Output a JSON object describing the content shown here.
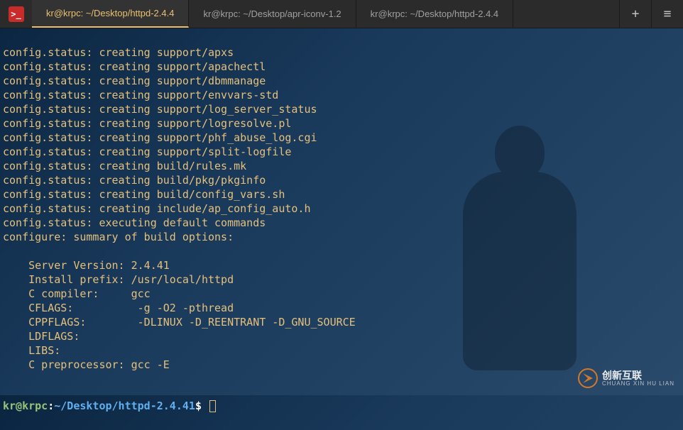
{
  "titlebar": {
    "app_icon_glyph": ">_",
    "tabs": [
      {
        "label": "kr@krpc: ~/Desktop/httpd-2.4.4",
        "active": true
      },
      {
        "label": "kr@krpc: ~/Desktop/apr-iconv-1.2",
        "active": false
      },
      {
        "label": "kr@krpc: ~/Desktop/httpd-2.4.4",
        "active": false
      }
    ],
    "new_tab_glyph": "+",
    "menu_glyph": "≡"
  },
  "terminal": {
    "config_lines": [
      "config.status: creating support/apxs",
      "config.status: creating support/apachectl",
      "config.status: creating support/dbmmanage",
      "config.status: creating support/envvars-std",
      "config.status: creating support/log_server_status",
      "config.status: creating support/logresolve.pl",
      "config.status: creating support/phf_abuse_log.cgi",
      "config.status: creating support/split-logfile",
      "config.status: creating build/rules.mk",
      "config.status: creating build/pkg/pkginfo",
      "config.status: creating build/config_vars.sh",
      "config.status: creating include/ap_config_auto.h",
      "config.status: executing default commands",
      "configure: summary of build options:",
      "",
      "    Server Version: 2.4.41",
      "    Install prefix: /usr/local/httpd",
      "    C compiler:     gcc",
      "    CFLAGS:          -g -O2 -pthread  ",
      "    CPPFLAGS:        -DLINUX -D_REENTRANT -D_GNU_SOURCE  ",
      "    LDFLAGS:           ",
      "    LIBS:             ",
      "    C preprocessor: gcc -E"
    ],
    "prompt": {
      "user": "kr@krpc",
      "sep1": ":",
      "path": "~/Desktop/httpd-2.4.41",
      "sep2": "$"
    }
  },
  "watermark": {
    "main": "创新互联",
    "sub": "CHUANG XIN HU LIAN"
  }
}
